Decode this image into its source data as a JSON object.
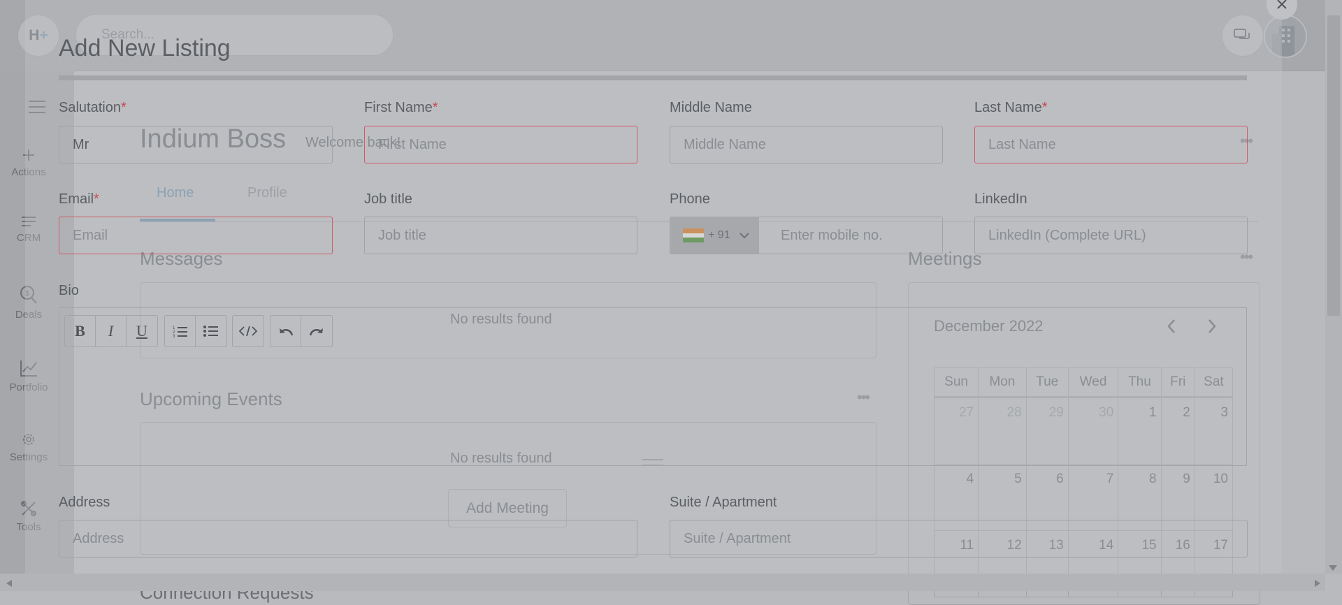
{
  "app": {
    "logo_text": "H",
    "logo_plus": "+",
    "search_placeholder": "Search...",
    "sidebar": [
      {
        "label": "Actions",
        "icon": "plus-icon"
      },
      {
        "label": "CRM",
        "icon": "list-icon"
      },
      {
        "label": "Deals",
        "icon": "deals-search-icon"
      },
      {
        "label": "Portfolio",
        "icon": "chart-line-icon"
      },
      {
        "label": "Settings",
        "icon": "gear-icon"
      },
      {
        "label": "Tools",
        "icon": "tools-icon"
      }
    ],
    "greeting": {
      "name": "Indium Boss",
      "welcome": "Welcome back!"
    },
    "tabs": [
      {
        "label": "Home"
      },
      {
        "label": "Profile"
      }
    ],
    "messages": {
      "title": "Messages",
      "empty": "No results found"
    },
    "events": {
      "title": "Upcoming Events",
      "empty": "No results found",
      "cta": "Add Meeting"
    },
    "cutoff_section_title": "Connection Requests",
    "meetings": {
      "title": "Meetings",
      "month": "December 2022",
      "weekdays": [
        "Sun",
        "Mon",
        "Tue",
        "Wed",
        "Thu",
        "Fri",
        "Sat"
      ],
      "weeks": [
        [
          {
            "d": "27",
            "muted": true
          },
          {
            "d": "28",
            "muted": true
          },
          {
            "d": "29",
            "muted": true
          },
          {
            "d": "30",
            "muted": true
          },
          {
            "d": "1"
          },
          {
            "d": "2"
          },
          {
            "d": "3"
          }
        ],
        [
          {
            "d": "4"
          },
          {
            "d": "5"
          },
          {
            "d": "6"
          },
          {
            "d": "7"
          },
          {
            "d": "8"
          },
          {
            "d": "9"
          },
          {
            "d": "10"
          }
        ],
        [
          {
            "d": "11"
          },
          {
            "d": "12"
          },
          {
            "d": "13"
          },
          {
            "d": "14"
          },
          {
            "d": "15"
          },
          {
            "d": "16"
          },
          {
            "d": "17"
          }
        ]
      ]
    }
  },
  "modal": {
    "title": "Add New Listing",
    "fields": {
      "salutation": {
        "label": "Salutation",
        "value": "Mr"
      },
      "first_name": {
        "label": "First Name",
        "placeholder": "First Name"
      },
      "middle_name": {
        "label": "Middle Name",
        "placeholder": "Middle Name"
      },
      "last_name": {
        "label": "Last Name",
        "placeholder": "Last Name"
      },
      "email": {
        "label": "Email",
        "placeholder": "Email"
      },
      "job_title": {
        "label": "Job title",
        "placeholder": "Job title"
      },
      "phone": {
        "label": "Phone",
        "country_code": "+ 91",
        "placeholder": "Enter mobile no."
      },
      "linkedin": {
        "label": "LinkedIn",
        "placeholder": "LinkedIn (Complete URL)"
      },
      "bio": {
        "label": "Bio"
      },
      "address": {
        "label": "Address",
        "placeholder": "Address"
      },
      "suite": {
        "label": "Suite / Apartment",
        "placeholder": "Suite / Apartment"
      }
    },
    "required_marker": "*",
    "toolbar": [
      {
        "name": "bold-button",
        "glyph": "B"
      },
      {
        "name": "italic-button",
        "glyph": "I"
      },
      {
        "name": "underline-button",
        "glyph": "U"
      }
    ]
  },
  "colors": {
    "error": "#cf5b67",
    "accent": "#6f8ea8"
  }
}
